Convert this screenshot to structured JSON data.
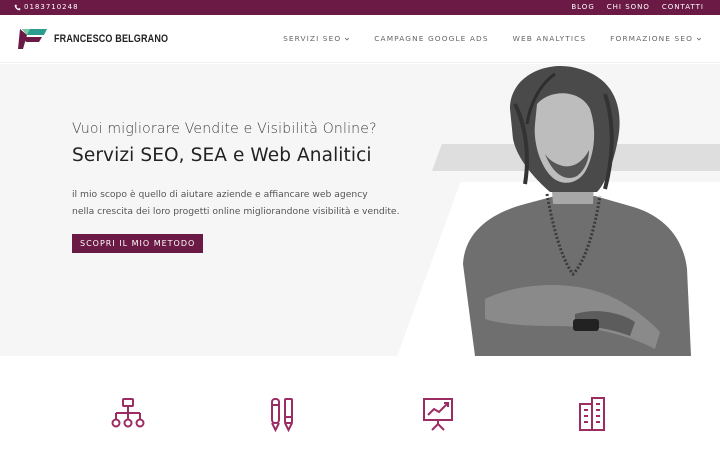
{
  "topbar": {
    "phone_icon": "phone-icon",
    "phone": "0183710248",
    "links": [
      "BLOG",
      "CHI SONO",
      "CONTATTI"
    ]
  },
  "header": {
    "logo_text": "FRANCESCO BELGRANO",
    "nav": [
      {
        "label": "SERVIZI SEO",
        "dropdown": true
      },
      {
        "label": "CAMPAGNE GOOGLE ADS",
        "dropdown": false
      },
      {
        "label": "WEB ANALYTICS",
        "dropdown": false
      },
      {
        "label": "FORMAZIONE SEO",
        "dropdown": true
      }
    ]
  },
  "hero": {
    "subtitle": "Vuoi migliorare Vendite e Visibilità Online?",
    "title": "Servizi SEO, SEA e Web Analitici",
    "desc_line1": "il mio scopo è quello di aiutare aziende e affiancare web agency",
    "desc_line2": "nella crescita dei loro progetti online migliorandone visibilità e vendite.",
    "cta": "SCOPRI IL MIO METODO"
  },
  "services": {
    "icons": [
      "sitemap-icon",
      "pencil-tools-icon",
      "presentation-chart-icon",
      "buildings-icon"
    ]
  },
  "colors": {
    "brand": "#6a1a45",
    "accent_icon": "#9b2d63",
    "hero_bg": "#f6f6f6",
    "band": "#dedede"
  }
}
